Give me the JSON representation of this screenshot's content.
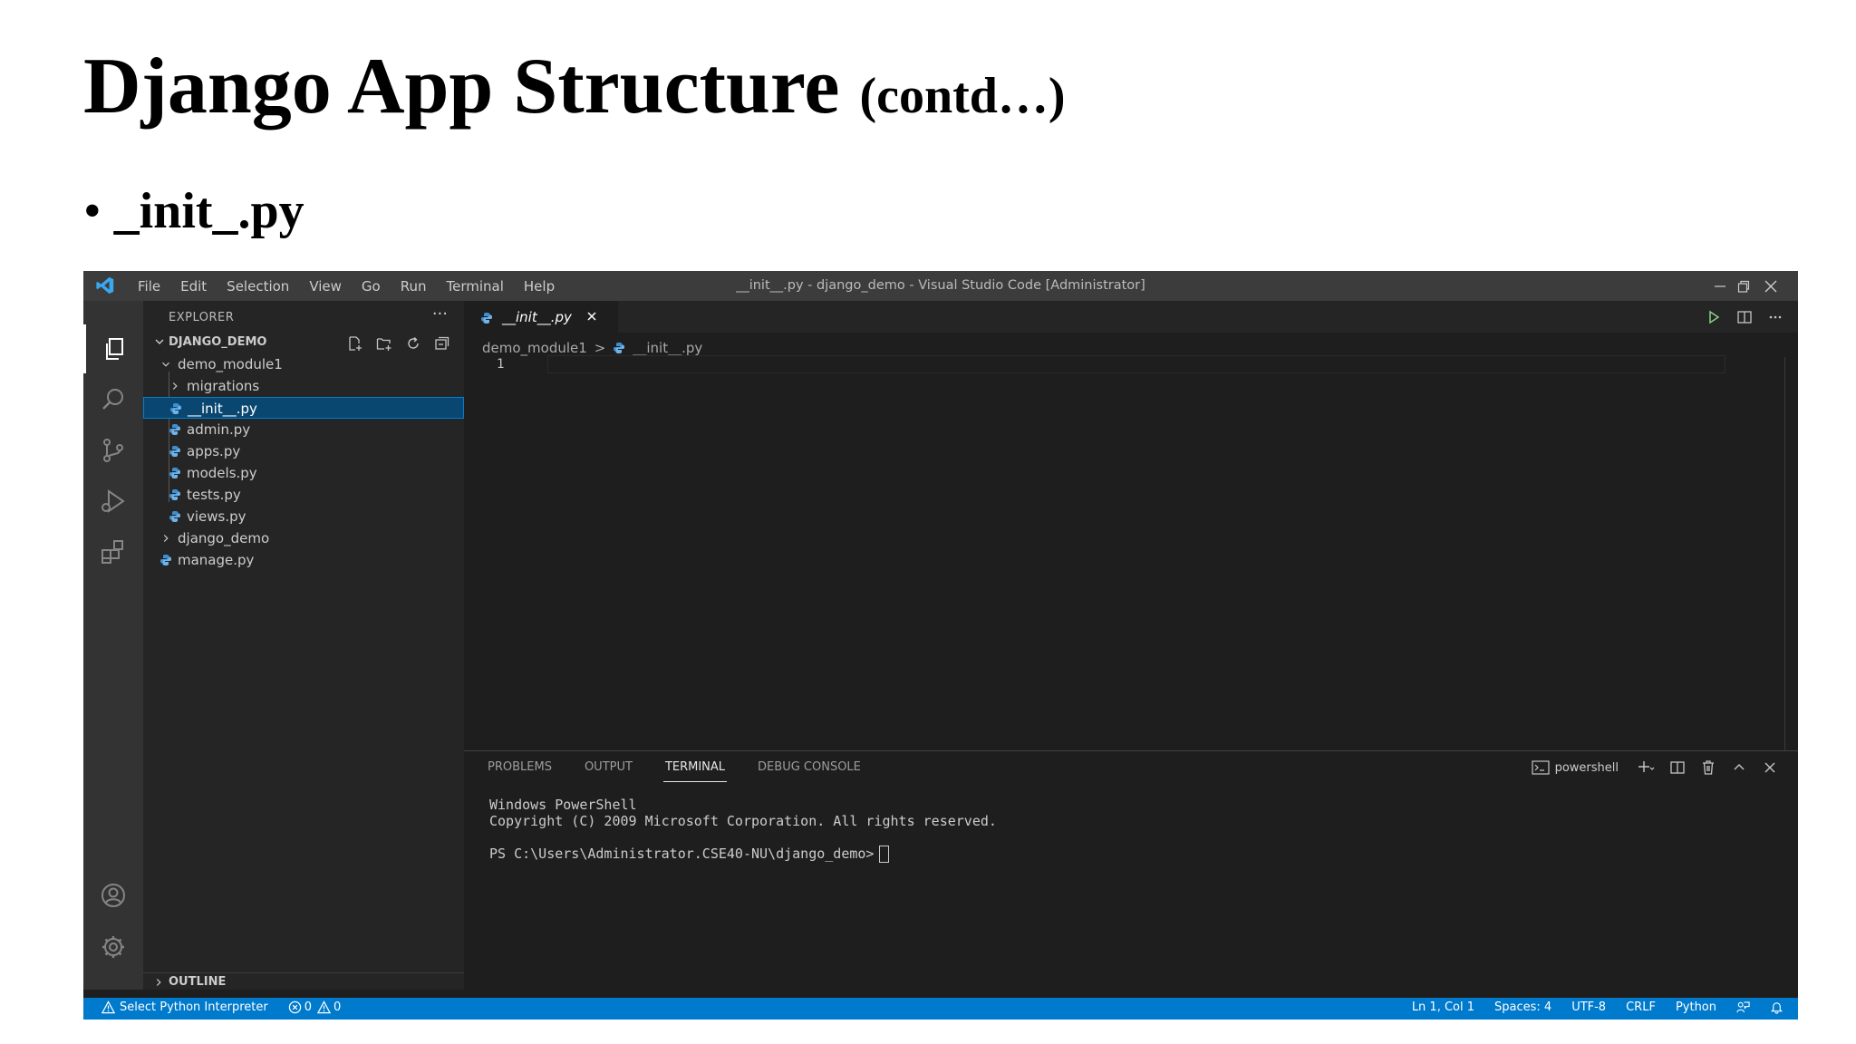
{
  "slide": {
    "title": "Django App Structure",
    "title_suffix": "(contd…)",
    "bullet": "_init_.py"
  },
  "window": {
    "title": "__init__.py - django_demo - Visual Studio Code [Administrator]",
    "menu": [
      "File",
      "Edit",
      "Selection",
      "View",
      "Go",
      "Run",
      "Terminal",
      "Help"
    ]
  },
  "sidebar": {
    "header": "EXPLORER",
    "more": "···",
    "project": "DJANGO_DEMO",
    "tree": [
      {
        "label": "demo_module1",
        "kind": "folder-open"
      },
      {
        "label": "migrations",
        "kind": "folder"
      },
      {
        "label": "__init__.py",
        "kind": "python",
        "selected": true
      },
      {
        "label": "admin.py",
        "kind": "python"
      },
      {
        "label": "apps.py",
        "kind": "python"
      },
      {
        "label": "models.py",
        "kind": "python"
      },
      {
        "label": "tests.py",
        "kind": "python"
      },
      {
        "label": "views.py",
        "kind": "python"
      },
      {
        "label": "django_demo",
        "kind": "folder"
      },
      {
        "label": "manage.py",
        "kind": "python"
      }
    ],
    "outline": "OUTLINE"
  },
  "editor": {
    "tab": "__init__.py",
    "breadcrumb": [
      "demo_module1",
      "__init__.py"
    ],
    "line_number": "1"
  },
  "panel": {
    "tabs": [
      "PROBLEMS",
      "OUTPUT",
      "TERMINAL",
      "DEBUG CONSOLE"
    ],
    "active_tab": "TERMINAL",
    "shell": "powershell",
    "terminal_lines": [
      "Windows PowerShell",
      "Copyright (C) 2009 Microsoft Corporation. All rights reserved.",
      "",
      "PS C:\\Users\\Administrator.CSE40-NU\\django_demo>"
    ]
  },
  "statusbar": {
    "interpreter": "Select Python Interpreter",
    "errors": "0",
    "warnings": "0",
    "position": "Ln 1, Col 1",
    "spaces": "Spaces: 4",
    "encoding": "UTF-8",
    "eol": "CRLF",
    "language": "Python"
  },
  "colors": {
    "status_bar": "#007acc",
    "selection": "#094771",
    "python_icon": "#3e8fd0",
    "accent": "#0078d4"
  },
  "icons": {
    "activity": [
      "explorer-icon",
      "search-icon",
      "source-control-icon",
      "run-debug-icon",
      "extensions-icon",
      "account-icon",
      "settings-gear-icon"
    ]
  }
}
